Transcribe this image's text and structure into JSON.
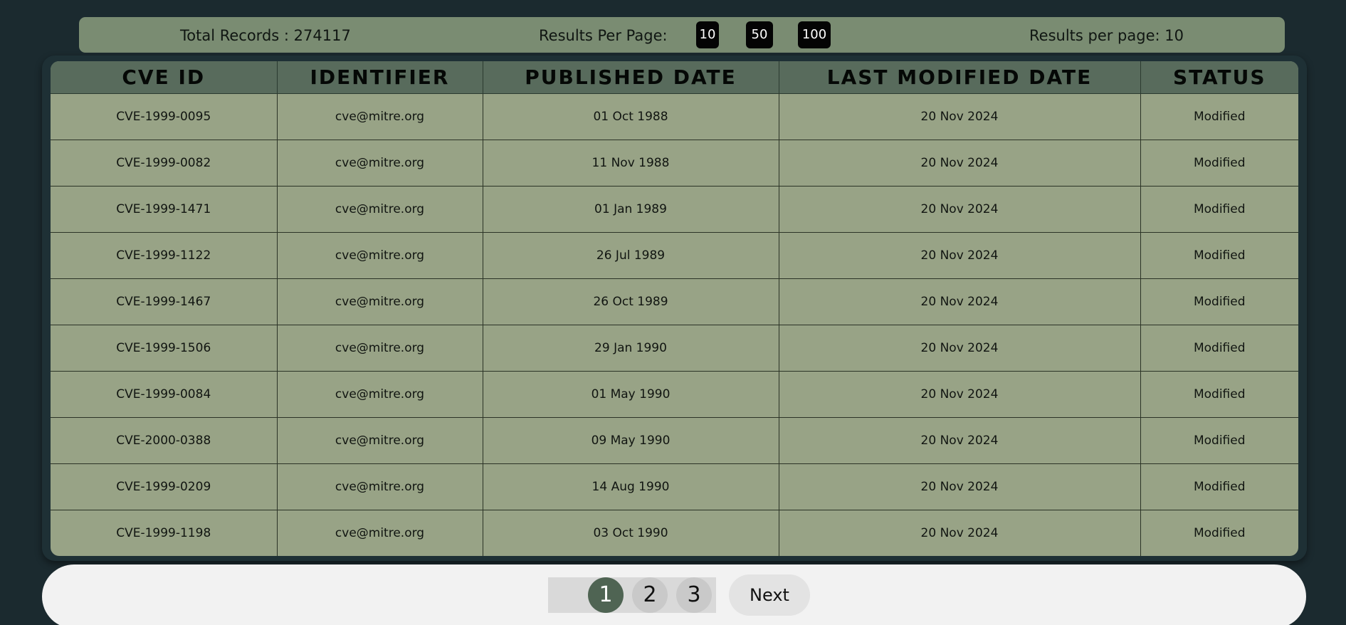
{
  "info_bar": {
    "total_records_text": "Total Records : 274117",
    "results_per_page_label": "Results Per Page:",
    "page_size_options": [
      "10",
      "50",
      "100"
    ],
    "results_per_page_current": "Results per page: 10"
  },
  "table": {
    "columns": [
      "CVE ID",
      "IDENTIFIER",
      "PUBLISHED DATE",
      "LAST MODIFIED DATE",
      "STATUS"
    ],
    "rows": [
      [
        "CVE-1999-0095",
        "cve@mitre.org",
        "01 Oct 1988",
        "20 Nov 2024",
        "Modified"
      ],
      [
        "CVE-1999-0082",
        "cve@mitre.org",
        "11 Nov 1988",
        "20 Nov 2024",
        "Modified"
      ],
      [
        "CVE-1999-1471",
        "cve@mitre.org",
        "01 Jan 1989",
        "20 Nov 2024",
        "Modified"
      ],
      [
        "CVE-1999-1122",
        "cve@mitre.org",
        "26 Jul 1989",
        "20 Nov 2024",
        "Modified"
      ],
      [
        "CVE-1999-1467",
        "cve@mitre.org",
        "26 Oct 1989",
        "20 Nov 2024",
        "Modified"
      ],
      [
        "CVE-1999-1506",
        "cve@mitre.org",
        "29 Jan 1990",
        "20 Nov 2024",
        "Modified"
      ],
      [
        "CVE-1999-0084",
        "cve@mitre.org",
        "01 May 1990",
        "20 Nov 2024",
        "Modified"
      ],
      [
        "CVE-2000-0388",
        "cve@mitre.org",
        "09 May 1990",
        "20 Nov 2024",
        "Modified"
      ],
      [
        "CVE-1999-0209",
        "cve@mitre.org",
        "14 Aug 1990",
        "20 Nov 2024",
        "Modified"
      ],
      [
        "CVE-1999-1198",
        "cve@mitre.org",
        "03 Oct 1990",
        "20 Nov 2024",
        "Modified"
      ]
    ]
  },
  "pagination": {
    "pages": [
      "1",
      "2",
      "3"
    ],
    "active_page": "1",
    "next_label": "Next"
  },
  "colors": {
    "background": "#1b2a2f",
    "info_bar": "#7a8c72",
    "table_header": "#586b5c",
    "table_body": "#98a386",
    "active_page": "#4f6453"
  }
}
